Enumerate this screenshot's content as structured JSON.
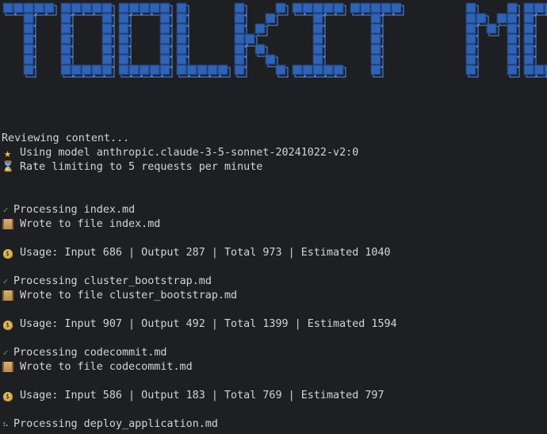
{
  "banner": {
    "title": "TOOLKIT MD",
    "primary_color": "#2f63b5",
    "shadow_color": "#5c8fe8"
  },
  "terminal": {
    "lines": [
      {
        "kind": "text",
        "icon": "",
        "text": "Reviewing content..."
      },
      {
        "kind": "text",
        "icon": "star-icon",
        "text": "Using model anthropic.claude-3-5-sonnet-20241022-v2:0"
      },
      {
        "kind": "text",
        "icon": "hourglass-icon",
        "text": "Rate limiting to 5 requests per minute"
      },
      {
        "kind": "gap"
      },
      {
        "kind": "gap"
      },
      {
        "kind": "text",
        "icon": "check-icon",
        "text": "Processing index.md"
      },
      {
        "kind": "text",
        "icon": "scroll-icon",
        "text": "Wrote to file index.md"
      },
      {
        "kind": "gap"
      },
      {
        "kind": "text",
        "icon": "money-bag-icon",
        "text": "Usage: Input 686 | Output 287 | Total 973 | Estimated 1040"
      },
      {
        "kind": "gap"
      },
      {
        "kind": "text",
        "icon": "check-icon",
        "text": "Processing cluster_bootstrap.md"
      },
      {
        "kind": "text",
        "icon": "scroll-icon",
        "text": "Wrote to file cluster_bootstrap.md"
      },
      {
        "kind": "gap"
      },
      {
        "kind": "text",
        "icon": "money-bag-icon",
        "text": "Usage: Input 907 | Output 492 | Total 1399 | Estimated 1594"
      },
      {
        "kind": "gap"
      },
      {
        "kind": "text",
        "icon": "check-icon",
        "text": "Processing codecommit.md"
      },
      {
        "kind": "text",
        "icon": "scroll-icon",
        "text": "Wrote to file codecommit.md"
      },
      {
        "kind": "gap"
      },
      {
        "kind": "text",
        "icon": "money-bag-icon",
        "text": "Usage: Input 586 | Output 183 | Total 769 | Estimated 797"
      },
      {
        "kind": "gap"
      },
      {
        "kind": "text",
        "icon": "spinner-icon",
        "text": "Processing deploy_application.md"
      }
    ]
  }
}
